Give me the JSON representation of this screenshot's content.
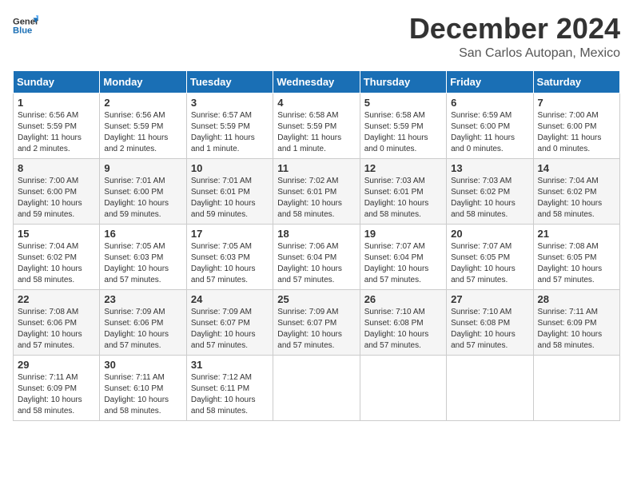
{
  "header": {
    "logo_general": "General",
    "logo_blue": "Blue",
    "month_title": "December 2024",
    "location": "San Carlos Autopan, Mexico"
  },
  "calendar": {
    "days_of_week": [
      "Sunday",
      "Monday",
      "Tuesday",
      "Wednesday",
      "Thursday",
      "Friday",
      "Saturday"
    ],
    "weeks": [
      [
        null,
        null,
        null,
        null,
        null,
        null,
        null
      ]
    ],
    "cells": [
      [
        {
          "day": "",
          "empty": true
        },
        {
          "day": "",
          "empty": true
        },
        {
          "day": "",
          "empty": true
        },
        {
          "day": "",
          "empty": true
        },
        {
          "day": "",
          "empty": true
        },
        {
          "day": "",
          "empty": true
        },
        {
          "day": "",
          "empty": true
        }
      ]
    ]
  },
  "days": [
    {
      "week": 0,
      "cells": [
        {
          "day": "1",
          "sunrise": "Sunrise: 6:56 AM",
          "sunset": "Sunset: 5:59 PM",
          "daylight": "Daylight: 11 hours and 2 minutes."
        },
        {
          "day": "2",
          "sunrise": "Sunrise: 6:56 AM",
          "sunset": "Sunset: 5:59 PM",
          "daylight": "Daylight: 11 hours and 2 minutes."
        },
        {
          "day": "3",
          "sunrise": "Sunrise: 6:57 AM",
          "sunset": "Sunset: 5:59 PM",
          "daylight": "Daylight: 11 hours and 1 minute."
        },
        {
          "day": "4",
          "sunrise": "Sunrise: 6:58 AM",
          "sunset": "Sunset: 5:59 PM",
          "daylight": "Daylight: 11 hours and 1 minute."
        },
        {
          "day": "5",
          "sunrise": "Sunrise: 6:58 AM",
          "sunset": "Sunset: 5:59 PM",
          "daylight": "Daylight: 11 hours and 0 minutes."
        },
        {
          "day": "6",
          "sunrise": "Sunrise: 6:59 AM",
          "sunset": "Sunset: 6:00 PM",
          "daylight": "Daylight: 11 hours and 0 minutes."
        },
        {
          "day": "7",
          "sunrise": "Sunrise: 7:00 AM",
          "sunset": "Sunset: 6:00 PM",
          "daylight": "Daylight: 11 hours and 0 minutes."
        }
      ]
    },
    {
      "week": 1,
      "cells": [
        {
          "day": "8",
          "sunrise": "Sunrise: 7:00 AM",
          "sunset": "Sunset: 6:00 PM",
          "daylight": "Daylight: 10 hours and 59 minutes."
        },
        {
          "day": "9",
          "sunrise": "Sunrise: 7:01 AM",
          "sunset": "Sunset: 6:00 PM",
          "daylight": "Daylight: 10 hours and 59 minutes."
        },
        {
          "day": "10",
          "sunrise": "Sunrise: 7:01 AM",
          "sunset": "Sunset: 6:01 PM",
          "daylight": "Daylight: 10 hours and 59 minutes."
        },
        {
          "day": "11",
          "sunrise": "Sunrise: 7:02 AM",
          "sunset": "Sunset: 6:01 PM",
          "daylight": "Daylight: 10 hours and 58 minutes."
        },
        {
          "day": "12",
          "sunrise": "Sunrise: 7:03 AM",
          "sunset": "Sunset: 6:01 PM",
          "daylight": "Daylight: 10 hours and 58 minutes."
        },
        {
          "day": "13",
          "sunrise": "Sunrise: 7:03 AM",
          "sunset": "Sunset: 6:02 PM",
          "daylight": "Daylight: 10 hours and 58 minutes."
        },
        {
          "day": "14",
          "sunrise": "Sunrise: 7:04 AM",
          "sunset": "Sunset: 6:02 PM",
          "daylight": "Daylight: 10 hours and 58 minutes."
        }
      ]
    },
    {
      "week": 2,
      "cells": [
        {
          "day": "15",
          "sunrise": "Sunrise: 7:04 AM",
          "sunset": "Sunset: 6:02 PM",
          "daylight": "Daylight: 10 hours and 58 minutes."
        },
        {
          "day": "16",
          "sunrise": "Sunrise: 7:05 AM",
          "sunset": "Sunset: 6:03 PM",
          "daylight": "Daylight: 10 hours and 57 minutes."
        },
        {
          "day": "17",
          "sunrise": "Sunrise: 7:05 AM",
          "sunset": "Sunset: 6:03 PM",
          "daylight": "Daylight: 10 hours and 57 minutes."
        },
        {
          "day": "18",
          "sunrise": "Sunrise: 7:06 AM",
          "sunset": "Sunset: 6:04 PM",
          "daylight": "Daylight: 10 hours and 57 minutes."
        },
        {
          "day": "19",
          "sunrise": "Sunrise: 7:07 AM",
          "sunset": "Sunset: 6:04 PM",
          "daylight": "Daylight: 10 hours and 57 minutes."
        },
        {
          "day": "20",
          "sunrise": "Sunrise: 7:07 AM",
          "sunset": "Sunset: 6:05 PM",
          "daylight": "Daylight: 10 hours and 57 minutes."
        },
        {
          "day": "21",
          "sunrise": "Sunrise: 7:08 AM",
          "sunset": "Sunset: 6:05 PM",
          "daylight": "Daylight: 10 hours and 57 minutes."
        }
      ]
    },
    {
      "week": 3,
      "cells": [
        {
          "day": "22",
          "sunrise": "Sunrise: 7:08 AM",
          "sunset": "Sunset: 6:06 PM",
          "daylight": "Daylight: 10 hours and 57 minutes."
        },
        {
          "day": "23",
          "sunrise": "Sunrise: 7:09 AM",
          "sunset": "Sunset: 6:06 PM",
          "daylight": "Daylight: 10 hours and 57 minutes."
        },
        {
          "day": "24",
          "sunrise": "Sunrise: 7:09 AM",
          "sunset": "Sunset: 6:07 PM",
          "daylight": "Daylight: 10 hours and 57 minutes."
        },
        {
          "day": "25",
          "sunrise": "Sunrise: 7:09 AM",
          "sunset": "Sunset: 6:07 PM",
          "daylight": "Daylight: 10 hours and 57 minutes."
        },
        {
          "day": "26",
          "sunrise": "Sunrise: 7:10 AM",
          "sunset": "Sunset: 6:08 PM",
          "daylight": "Daylight: 10 hours and 57 minutes."
        },
        {
          "day": "27",
          "sunrise": "Sunrise: 7:10 AM",
          "sunset": "Sunset: 6:08 PM",
          "daylight": "Daylight: 10 hours and 57 minutes."
        },
        {
          "day": "28",
          "sunrise": "Sunrise: 7:11 AM",
          "sunset": "Sunset: 6:09 PM",
          "daylight": "Daylight: 10 hours and 58 minutes."
        }
      ]
    },
    {
      "week": 4,
      "cells": [
        {
          "day": "29",
          "sunrise": "Sunrise: 7:11 AM",
          "sunset": "Sunset: 6:09 PM",
          "daylight": "Daylight: 10 hours and 58 minutes."
        },
        {
          "day": "30",
          "sunrise": "Sunrise: 7:11 AM",
          "sunset": "Sunset: 6:10 PM",
          "daylight": "Daylight: 10 hours and 58 minutes."
        },
        {
          "day": "31",
          "sunrise": "Sunrise: 7:12 AM",
          "sunset": "Sunset: 6:11 PM",
          "daylight": "Daylight: 10 hours and 58 minutes."
        },
        {
          "day": "",
          "empty": true
        },
        {
          "day": "",
          "empty": true
        },
        {
          "day": "",
          "empty": true
        },
        {
          "day": "",
          "empty": true
        }
      ]
    }
  ]
}
